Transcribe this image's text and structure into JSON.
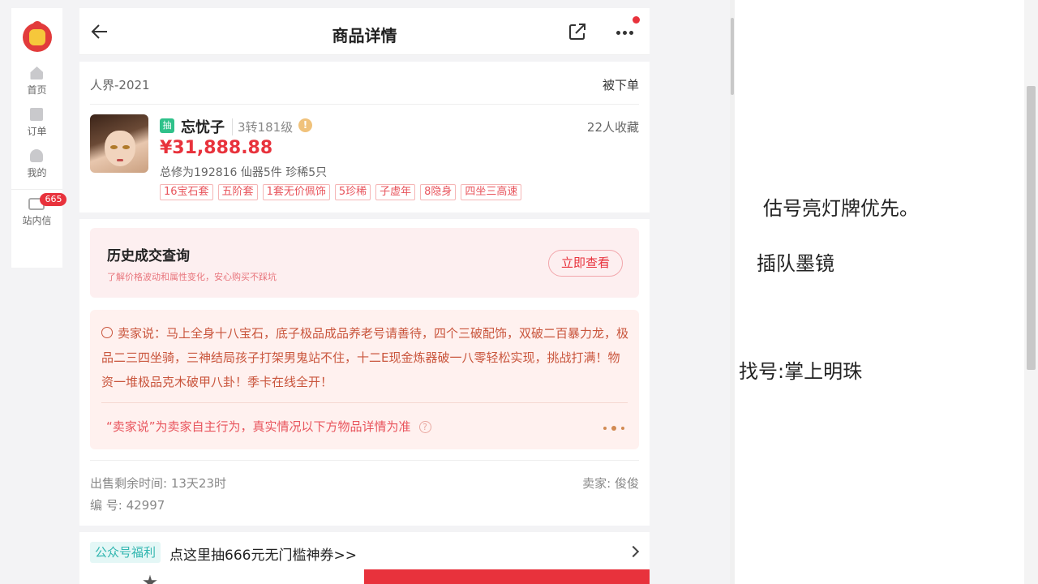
{
  "sidebar": {
    "items": [
      {
        "label": "首页",
        "icon": "home-icon"
      },
      {
        "label": "订单",
        "icon": "order-icon"
      },
      {
        "label": "我的",
        "icon": "user-icon"
      }
    ],
    "messages": {
      "label": "站内信",
      "badge": "665",
      "icon": "mail-icon"
    }
  },
  "header": {
    "title": "商品详情",
    "back_icon": "back-arrow-icon",
    "share_icon": "share-icon",
    "more_icon": "more-icon"
  },
  "product": {
    "server": "人界-2021",
    "order_status": "被下单",
    "tag": "抽",
    "name": "忘忧子",
    "level": "3转181级",
    "warn_mark": "!",
    "favorites": "22人收藏",
    "price": "¥31,888.88",
    "stats": "总修为192816  仙器5件  珍稀5只",
    "chips": [
      "16宝石套",
      "五阶套",
      "1套无价佩饰",
      "5珍稀",
      "子虚年",
      "8隐身",
      "四坐三高速"
    ]
  },
  "history": {
    "title": "历史成交查询",
    "subtitle": "了解价格波动和属性变化，安心购买不踩坑",
    "button": "立即查看"
  },
  "seller_says": {
    "text": "卖家说：马上全身十八宝石，底子极品成品养老号请善待，四个三破配饰，双破二百暴力龙，极品二三四坐骑，三神结局孩子打架男鬼站不住，十二E现金炼器破一八零轻松实现，挑战打满！物资一堆极品克木破甲八卦！季卡在线全开！",
    "note": "“卖家说”为卖家自主行为，真实情况以下方物品详情为准",
    "help_mark": "?"
  },
  "meta": {
    "remaining": "出售剩余时间: 13天23时",
    "code": "编 号: 42997",
    "seller": "卖家: 俊俊"
  },
  "promo": {
    "tag": "公众号福利",
    "text": "点这里抽666元无门槛神券>>"
  },
  "notes": [
    "估号亮灯牌优先。",
    "插队墨镜",
    "找号:掌上明珠"
  ],
  "colors": {
    "accent": "#e8323c",
    "teal": "#32b6b0",
    "seller_text": "#c9553c"
  }
}
